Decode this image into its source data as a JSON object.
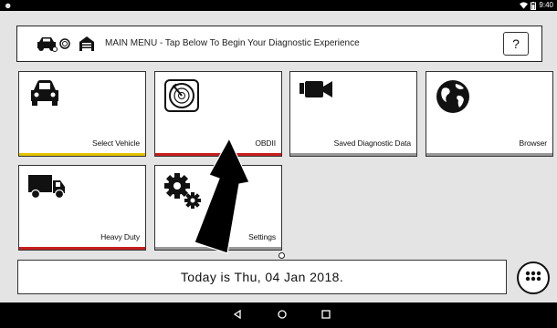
{
  "status_bar": {
    "android_icon": "android-icon",
    "wifi_icon": "wifi-icon",
    "battery_icon": "battery-icon",
    "time": "9:40"
  },
  "header": {
    "title": "MAIN MENU - Tap Below To Begin Your Diagnostic Experience",
    "help_label": "?"
  },
  "tiles": [
    {
      "label": "Select Vehicle",
      "icon": "car-icon",
      "bar_color": "#e4c400"
    },
    {
      "label": "OBDII",
      "icon": "radar-icon",
      "bar_color": "#c81e1e"
    },
    {
      "label": "Saved Diagnostic Data",
      "icon": "video-camera-icon",
      "bar_color": "#9a9a9a"
    },
    {
      "label": "Browser",
      "icon": "globe-icon",
      "bar_color": "#9a9a9a"
    },
    {
      "label": "Heavy Duty",
      "icon": "truck-icon",
      "bar_color": "#c81e1e"
    },
    {
      "label": "Settings",
      "icon": "gears-icon",
      "bar_color": "#9a9a9a"
    }
  ],
  "date_text": "Today is Thu, 04 Jan 2018.",
  "colors": {
    "background": "#e4e4e4",
    "yellow_bar": "#e4c400",
    "red_bar": "#c81e1e",
    "gray_bar": "#9a9a9a"
  }
}
